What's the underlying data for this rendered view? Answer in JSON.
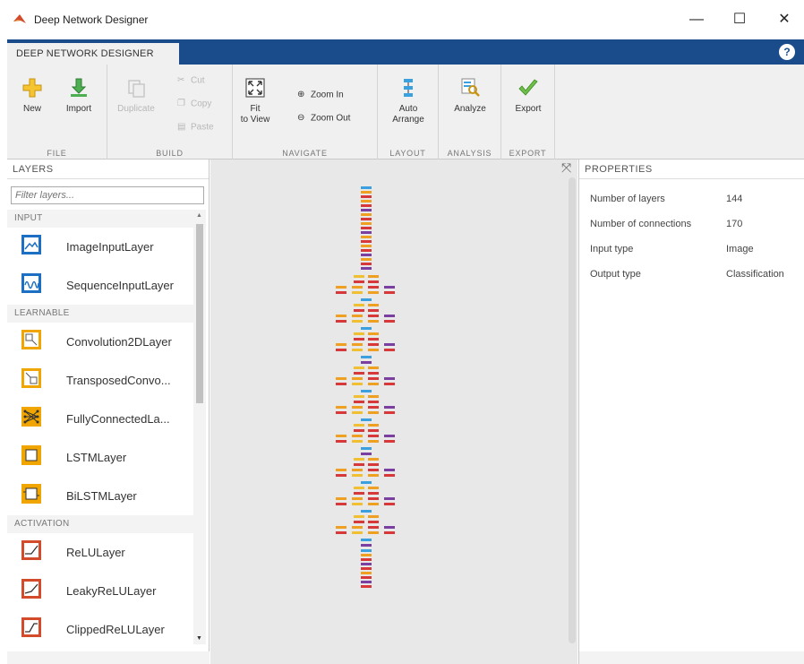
{
  "window": {
    "title": "Deep Network Designer",
    "minimize": "—",
    "maximize": "☐",
    "close": "✕"
  },
  "tabstrip": {
    "tab_label": "DEEP NETWORK DESIGNER",
    "help": "?"
  },
  "toolstrip": {
    "file": {
      "label": "FILE",
      "new": "New",
      "import": "Import"
    },
    "build": {
      "label": "BUILD",
      "duplicate": "Duplicate",
      "cut": "Cut",
      "copy": "Copy",
      "paste": "Paste"
    },
    "navigate": {
      "label": "NAVIGATE",
      "fit_line1": "Fit",
      "fit_line2": "to View",
      "zoom_in": "Zoom In",
      "zoom_out": "Zoom Out"
    },
    "layout": {
      "label": "LAYOUT",
      "auto_line1": "Auto",
      "auto_line2": "Arrange"
    },
    "analysis": {
      "label": "ANALYSIS",
      "analyze": "Analyze"
    },
    "export": {
      "label": "EXPORT",
      "export": "Export"
    }
  },
  "layers": {
    "header": "LAYERS",
    "filter_placeholder": "Filter layers...",
    "categories": [
      {
        "name": "INPUT",
        "items": [
          "ImageInputLayer",
          "SequenceInputLayer"
        ]
      },
      {
        "name": "LEARNABLE",
        "items": [
          "Convolution2DLayer",
          "TransposedConvo...",
          "FullyConnectedLa...",
          "LSTMLayer",
          "BiLSTMLayer"
        ]
      },
      {
        "name": "ACTIVATION",
        "items": [
          "ReLULayer",
          "LeakyReLULayer",
          "ClippedReLULayer"
        ]
      }
    ]
  },
  "properties": {
    "header": "PROPERTIES",
    "rows": [
      {
        "key": "Number of layers",
        "value": "144"
      },
      {
        "key": "Number of connections",
        "value": "170"
      },
      {
        "key": "Input type",
        "value": "Image"
      },
      {
        "key": "Output type",
        "value": "Classification"
      }
    ]
  },
  "colors": {
    "tab_blue": "#1a4c8c",
    "input_blue": "#1d6fc4",
    "learnable_orange": "#f0a500",
    "activation_red": "#d24b2a",
    "node_blue": "#3aa0e0",
    "node_red": "#d9383a",
    "node_orange": "#f0a020",
    "node_purple": "#7a3fa0",
    "node_yellow": "#f0c030"
  }
}
